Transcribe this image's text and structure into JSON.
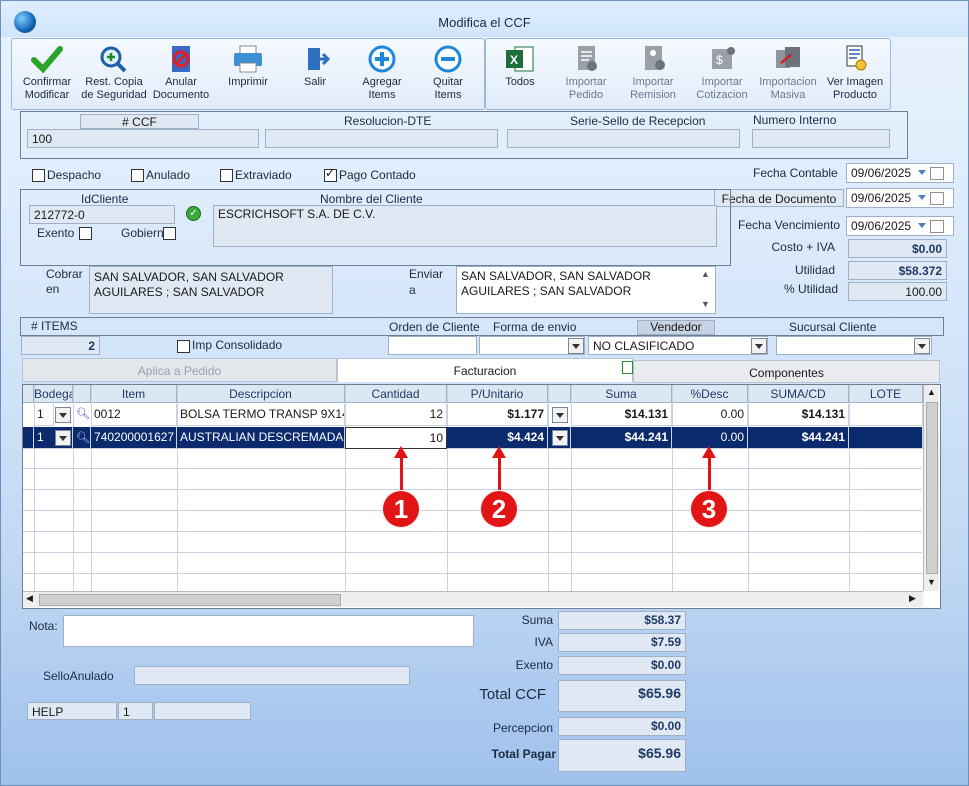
{
  "window": {
    "title": "Modifica el CCF"
  },
  "toolbar": [
    {
      "label1": "Confirmar",
      "label2": "Modificar",
      "icon": "check-icon"
    },
    {
      "label1": "Rest. Copia",
      "label2": "de Seguridad",
      "icon": "magnifier-plus-icon"
    },
    {
      "label1": "Anular",
      "label2": "Documento",
      "icon": "cancel-document-icon"
    },
    {
      "label1": "Imprimir",
      "label2": "",
      "icon": "printer-icon"
    },
    {
      "label1": "Salir",
      "label2": "",
      "icon": "exit-door-icon"
    },
    {
      "label1": "Agregar",
      "label2": "Items",
      "icon": "plus-circle-icon"
    },
    {
      "label1": "Quitar",
      "label2": "Items",
      "icon": "minus-circle-icon"
    },
    {
      "label1": "Todos",
      "label2": "",
      "icon": "excel-icon"
    },
    {
      "label1": "Importar",
      "label2": "Pedido",
      "icon": "import-order-icon"
    },
    {
      "label1": "Importar",
      "label2": "Remision",
      "icon": "import-remision-icon"
    },
    {
      "label1": "Importar",
      "label2": "Cotizacion",
      "icon": "import-quote-icon"
    },
    {
      "label1": "Importacion",
      "label2": "Masiva",
      "icon": "mass-import-icon"
    },
    {
      "label1": "Ver Imagen",
      "label2": "Producto",
      "icon": "product-image-icon"
    }
  ],
  "doc": {
    "ccf_label": "# CCF",
    "ccf_value": "100",
    "resolucion_label": "Resolucion-DTE",
    "resolucion_value": "",
    "serie_label": "Serie-Sello de Recepcion",
    "serie_value": "",
    "numero_label": "Numero Interno",
    "numero_value": ""
  },
  "flags": {
    "despacho": "Despacho",
    "anulado": "Anulado",
    "extraviado": "Extraviado",
    "pago_contado": "Pago Contado",
    "pago_contado_checked": true
  },
  "dates": {
    "contable_label": "Fecha Contable",
    "contable_value": "09/06/2025",
    "documento_label": "Fecha de  Documento",
    "documento_value": "09/06/2025",
    "vencimiento_label": "Fecha Vencimiento",
    "vencimiento_value": "09/06/2025"
  },
  "client": {
    "id_label": "IdCliente",
    "id_value": "212772-0",
    "name_label": "Nombre del Cliente",
    "name_value": "ESCRICHSOFT S.A. DE C.V.",
    "exento_label": "Exento",
    "gobierno_label": "Gobierno"
  },
  "metrics": {
    "costo_label": "Costo + IVA",
    "costo_value": "$0.00",
    "utilidad_label": "Utilidad",
    "utilidad_value": "$58.372",
    "pct_label": "% Utilidad",
    "pct_value": "100.00"
  },
  "address": {
    "cobrar_label1": "Cobrar",
    "cobrar_label2": "en",
    "cobrar_line1": "SAN SALVADOR, SAN SALVADOR",
    "cobrar_line2": "AGUILARES ; SAN SALVADOR",
    "enviar_label1": "Enviar",
    "enviar_label2": "a",
    "enviar_line1": "SAN SALVADOR, SAN SALVADOR",
    "enviar_line2": "AGUILARES ; SAN SALVADOR"
  },
  "order": {
    "items_label": "# ITEMS",
    "items_value": "2",
    "imp_label": "Imp Consolidado",
    "orden_label": "Orden de Cliente",
    "orden_value": "",
    "envio_label": "Forma de envio",
    "envio_value": "",
    "vendedor_label": "Vendedor",
    "vendedor_value": "NO CLASIFICADO",
    "sucursal_label": "Sucursal Cliente",
    "sucursal_value": ""
  },
  "tabs": [
    {
      "label": "Aplica a Pedido"
    },
    {
      "label": "Facturacion"
    },
    {
      "label": "Componentes"
    }
  ],
  "grid": {
    "columns": [
      "Bodega",
      "Item",
      "Descripcion",
      "Cantidad",
      "P/Unitario",
      "Suma",
      "%Desc",
      "SUMA/CD",
      "LOTE"
    ],
    "rows": [
      {
        "bodega": "1",
        "item": "0012",
        "desc": "BOLSA TERMO TRANSP 9X14",
        "cantidad": "12",
        "precio": "$1.177",
        "suma": "$14.131",
        "desc_pct": "0.00",
        "sumacd": "$14.131",
        "lote": ""
      },
      {
        "bodega": "1",
        "item": "740200001627",
        "desc": "AUSTRALIAN DESCREMADA",
        "cantidad": "10",
        "precio": "$4.424",
        "suma": "$44.241",
        "desc_pct": "0.00",
        "sumacd": "$44.241",
        "lote": ""
      }
    ]
  },
  "annotations": [
    "1",
    "2",
    "3"
  ],
  "footer": {
    "nota_label": "Nota:",
    "nota_value": "",
    "sello_label": "SelloAnulado",
    "sello_value": "",
    "help_label": "HELP",
    "help_value": "1",
    "help_extra": ""
  },
  "totals": {
    "suma_label": "Suma",
    "suma_value": "$58.37",
    "iva_label": "IVA",
    "iva_value": "$7.59",
    "exento_label": "Exento",
    "exento_value": "$0.00",
    "total_label": "Total CCF",
    "total_value": "$65.96",
    "percepcion_label": "Percepcion",
    "percepcion_value": "$0.00",
    "pagar_label": "Total Pagar",
    "pagar_value": "$65.96"
  }
}
